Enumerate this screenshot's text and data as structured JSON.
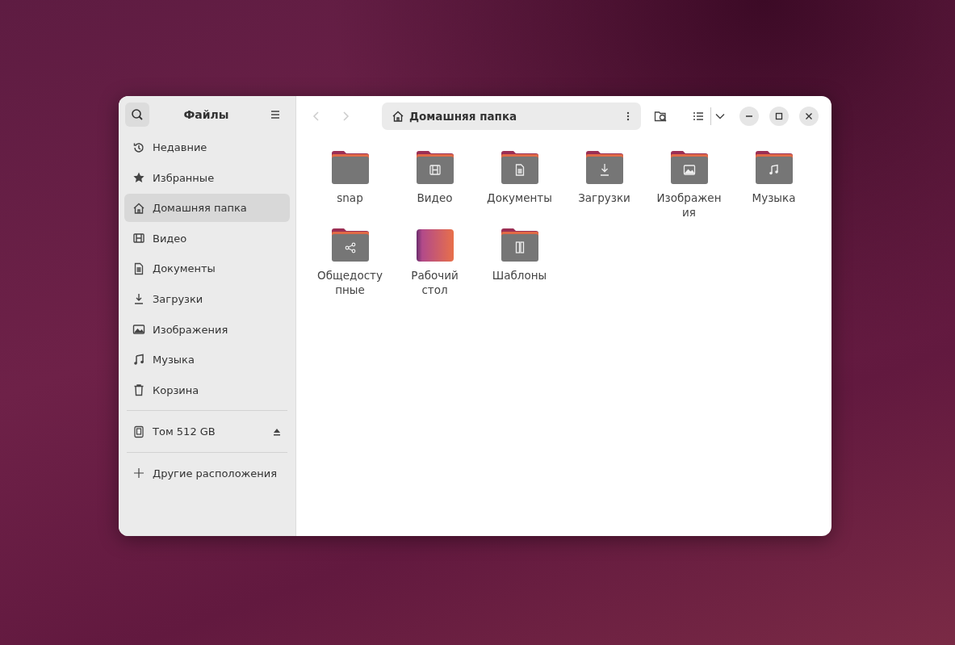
{
  "sidebar": {
    "title": "Файлы",
    "items": [
      {
        "label": "Недавние",
        "kind": "recent",
        "selected": false
      },
      {
        "label": "Избранные",
        "kind": "starred",
        "selected": false
      },
      {
        "label": "Домашняя папка",
        "kind": "home",
        "selected": true
      },
      {
        "label": "Видео",
        "kind": "video",
        "selected": false
      },
      {
        "label": "Документы",
        "kind": "documents",
        "selected": false
      },
      {
        "label": "Загрузки",
        "kind": "downloads",
        "selected": false
      },
      {
        "label": "Изображения",
        "kind": "pictures",
        "selected": false
      },
      {
        "label": "Музыка",
        "kind": "music",
        "selected": false
      },
      {
        "label": "Корзина",
        "kind": "trash",
        "selected": false
      }
    ],
    "devices": [
      {
        "label": "Том 512 GB"
      }
    ],
    "other": {
      "label": "Другие расположения"
    }
  },
  "path_bar": {
    "location": "Домашняя папка"
  },
  "files": [
    {
      "name": "snap",
      "kind": "folder"
    },
    {
      "name": "Видео",
      "kind": "video"
    },
    {
      "name": "Документы",
      "kind": "documents"
    },
    {
      "name": "Загрузки",
      "kind": "downloads"
    },
    {
      "name": "Изображения",
      "kind": "pictures"
    },
    {
      "name": "Музыка",
      "kind": "music"
    },
    {
      "name": "Общедоступные",
      "kind": "public"
    },
    {
      "name": "Рабочий стол",
      "kind": "desktop"
    },
    {
      "name": "Шаблоны",
      "kind": "templates"
    }
  ]
}
